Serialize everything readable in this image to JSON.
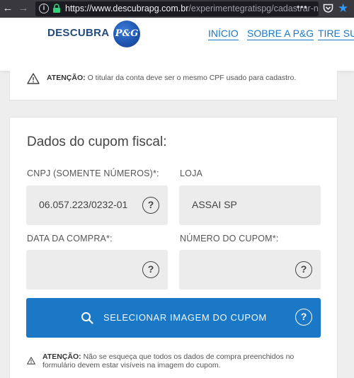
{
  "browser": {
    "url_host": "https://www.descubrapg.com.br",
    "url_path": "/experimentegratispg/cadastrar-n",
    "more_glyph": "•••"
  },
  "header": {
    "brand_word": "DESCUBRA",
    "logo_text": "P&G",
    "nav": [
      "INÍCIO",
      "SOBRE A P&G",
      "TIRE SUA"
    ]
  },
  "top_notice": {
    "label": "ATENÇÃO:",
    "text": "O titular da conta deve ser o mesmo CPF usado para cadastro."
  },
  "form": {
    "title": "Dados do cupom fiscal:",
    "cnpj_label": "CNPJ (SOMENTE NÚMEROS)*:",
    "cnpj_value": "06.057.223/0232-01",
    "loja_label": "LOJA",
    "loja_value": "ASSAI SP",
    "data_label": "DATA DA COMPRA*:",
    "data_value": "",
    "numero_label": "NÚMERO DO CUPOM*:",
    "numero_value": "",
    "help_glyph": "?",
    "upload_label": "SELECIONAR IMAGEM DO CUPOM"
  },
  "bottom_notice": {
    "label": "ATENÇÃO:",
    "text": "Não se esqueça que todos os dados de compra preenchidos no formulário devem estar visíveis na imagem do cupom."
  }
}
